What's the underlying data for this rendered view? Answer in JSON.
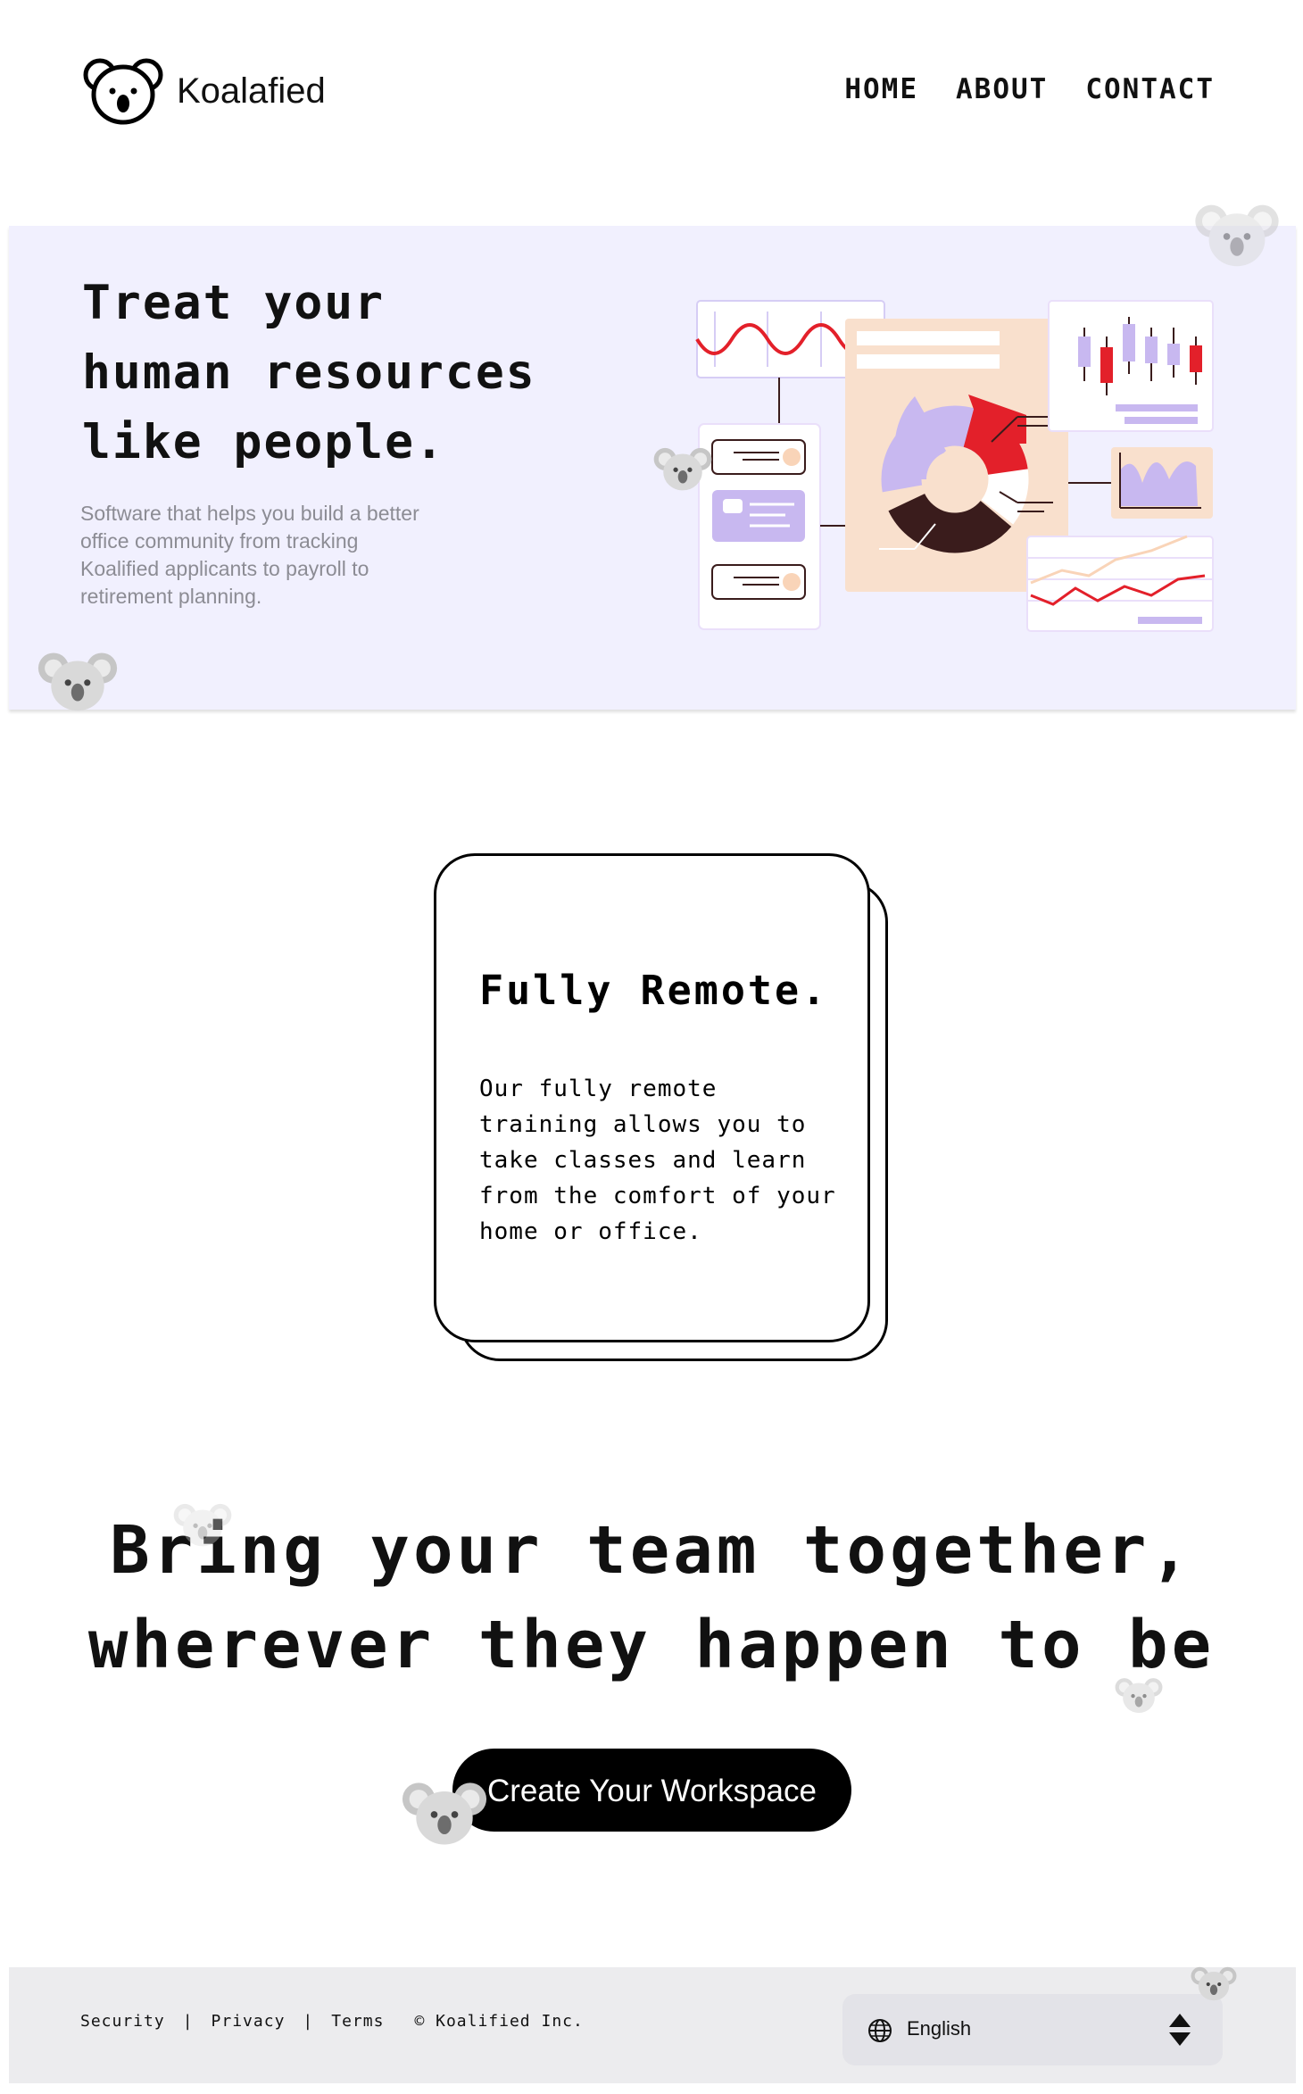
{
  "brand": {
    "name": "Koalafied",
    "logo_icon": "koala-logo-icon"
  },
  "nav": {
    "items": [
      "HOME",
      "ABOUT",
      "CONTACT"
    ]
  },
  "hero": {
    "title_lines": [
      "Treat your",
      "human resources",
      "like people."
    ],
    "subtitle": "Software that helps you build a better office community from tracking Koalified applicants to payroll to retirement planning.",
    "illustration": "hr-dashboard-illustration",
    "background": "#f1f0fe"
  },
  "feature": {
    "title": "Fully Remote.",
    "text": "Our fully remote training allows you to take classes and learn from the comfort of your home or office."
  },
  "cta": {
    "line1": "Bring your team together,",
    "line2": "wherever they happen to be",
    "button": "Create Your Workspace"
  },
  "footer": {
    "links": [
      "Security",
      "Privacy",
      "Terms"
    ],
    "separator": "|",
    "copyright": "© Koalified Inc.",
    "language": "English"
  },
  "colors": {
    "accent_red": "#e3202a",
    "lavender": "#c8b8f0",
    "peach": "#f9e0cd",
    "dark_brown": "#3a1c1c",
    "footer_bg": "#ececee"
  }
}
